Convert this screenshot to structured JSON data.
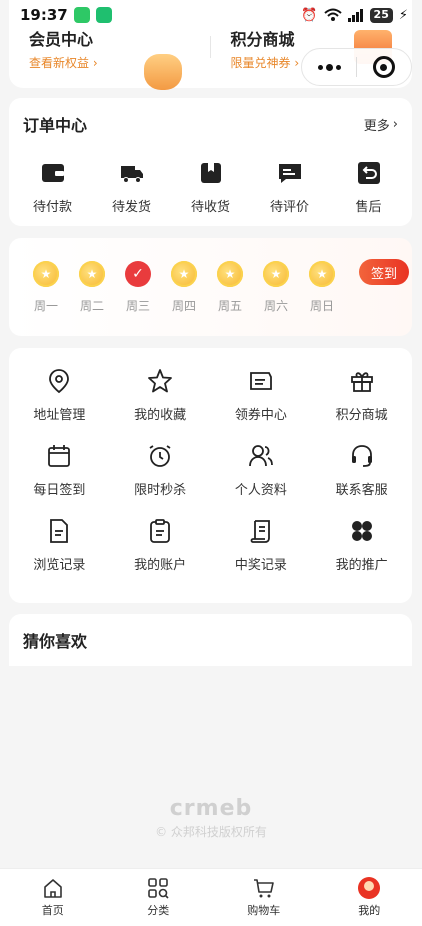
{
  "status_bar": {
    "time": "19:37",
    "battery": "25"
  },
  "member_card": {
    "vip_title": "会员中心",
    "vip_sub": "查看新权益",
    "points_title": "积分商城",
    "points_sub": "限量兑神券"
  },
  "orders": {
    "title": "订单中心",
    "more": "更多",
    "items": [
      {
        "label": "待付款",
        "icon": "wallet-icon"
      },
      {
        "label": "待发货",
        "icon": "truck-icon"
      },
      {
        "label": "待收货",
        "icon": "package-icon"
      },
      {
        "label": "待评价",
        "icon": "review-icon"
      },
      {
        "label": "售后",
        "icon": "return-icon"
      }
    ]
  },
  "sign_in": {
    "days": [
      "周一",
      "周二",
      "周三",
      "周四",
      "周五",
      "周六",
      "周日"
    ],
    "checked_day": "周三",
    "button": "签到"
  },
  "services": [
    {
      "label": "地址管理",
      "icon": "location-icon"
    },
    {
      "label": "我的收藏",
      "icon": "star-icon"
    },
    {
      "label": "领券中心",
      "icon": "coupon-icon"
    },
    {
      "label": "积分商城",
      "icon": "gift-icon"
    },
    {
      "label": "每日签到",
      "icon": "calendar-icon"
    },
    {
      "label": "限时秒杀",
      "icon": "alarm-clock-icon"
    },
    {
      "label": "个人资料",
      "icon": "profile-icon"
    },
    {
      "label": "联系客服",
      "icon": "headset-icon"
    },
    {
      "label": "浏览记录",
      "icon": "document-icon"
    },
    {
      "label": "我的账户",
      "icon": "clipboard-icon"
    },
    {
      "label": "中奖记录",
      "icon": "scroll-icon"
    },
    {
      "label": "我的推广",
      "icon": "clover-icon"
    }
  ],
  "guess": {
    "title": "猜你喜欢"
  },
  "brand": {
    "logo": "crmeb",
    "copyright": "© 众邦科技版权所有"
  },
  "tabbar": [
    {
      "label": "首页",
      "icon": "home-icon"
    },
    {
      "label": "分类",
      "icon": "category-icon"
    },
    {
      "label": "购物车",
      "icon": "cart-icon"
    },
    {
      "label": "我的",
      "icon": "me-icon",
      "active": true
    }
  ]
}
